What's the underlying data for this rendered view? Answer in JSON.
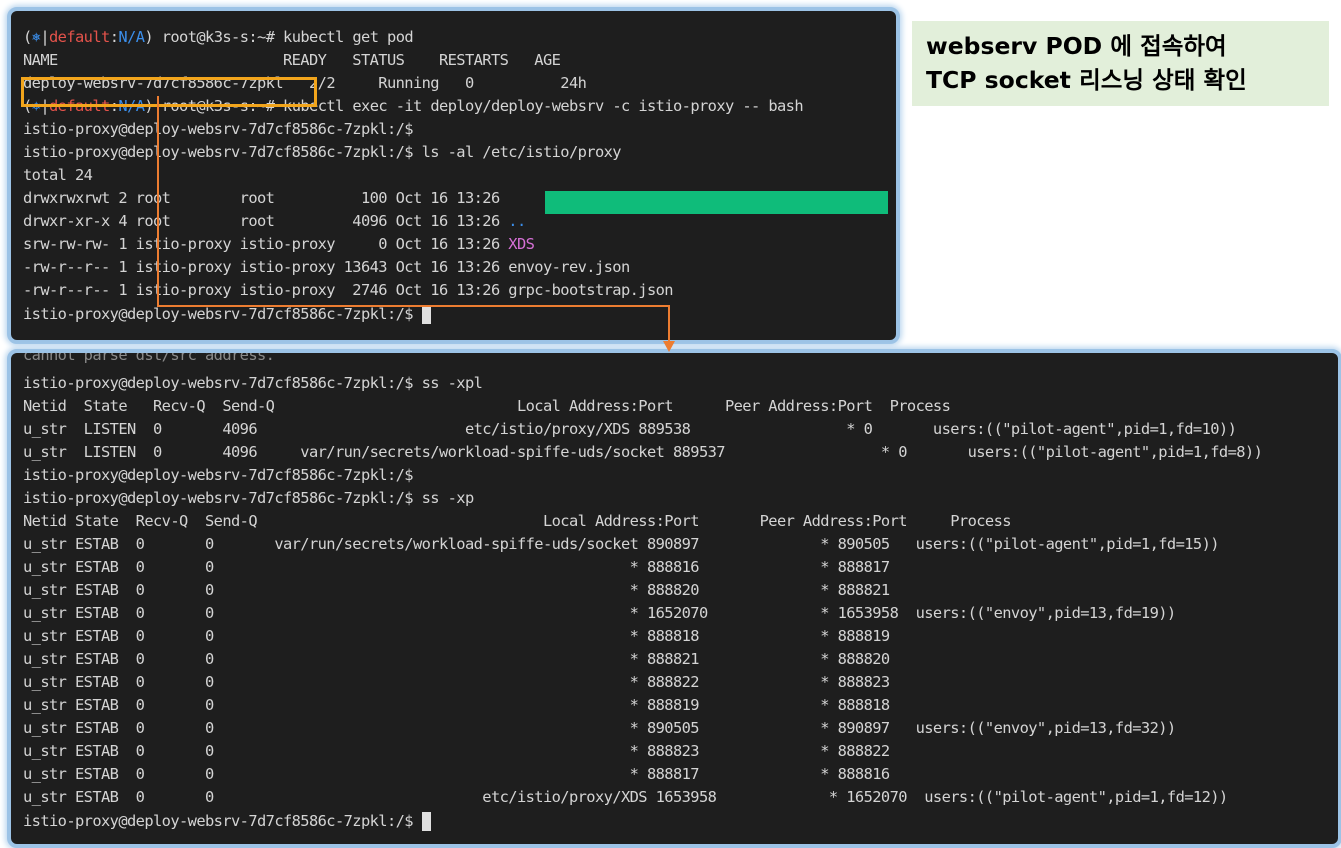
{
  "callout": {
    "line1": "webserv POD 에 접속하여",
    "line2": "TCP socket 리스닝 상태 확인"
  },
  "colors": {
    "terminal_bg": "#1e1e1e",
    "terminal_text": "#d4d4d4",
    "context_red": "#e5534b",
    "namespace_blue": "#3b8eea",
    "socket_magenta": "#d670d6",
    "dir_highlight_green": "#0fbc7a",
    "highlight_box_orange": "#f2a51c",
    "arrow_orange": "#ed7d31",
    "callout_bg": "#e2efda",
    "panel_border": "#9cc3e6"
  },
  "terminal1": {
    "prompt_star": "⎈",
    "prompt_ctx": "default",
    "prompt_ns": "N/A",
    "prompt_host": "root@k3s-s:~#",
    "cmd1": "kubectl get pod",
    "pod_header": "NAME                          READY   STATUS    RESTARTS   AGE",
    "pod_name": "deploy-websrv-7d7cf8586c-7zpkl",
    "pod_rest": "   2/2     Running   0          24h",
    "cmd2": "kubectl exec -it deploy/deploy-websrv -c istio-proxy -- bash",
    "shell_prompt": "istio-proxy@deploy-websrv-7d7cf8586c-7zpkl:/$",
    "cmd3": "ls -al /etc/istio/proxy",
    "total": "total 24",
    "files": [
      {
        "meta": "drwxrwxrwt 2 root        root          100 Oct 16 13:26 ",
        "name": "."
      },
      {
        "meta": "drwxr-xr-x 4 root        root         4096 Oct 16 13:26 ",
        "name": ".."
      },
      {
        "meta": "srw-rw-rw- 1 istio-proxy istio-proxy     0 Oct 16 13:26 ",
        "name": "XDS"
      },
      {
        "meta": "-rw-r--r-- 1 istio-proxy istio-proxy 13643 Oct 16 13:26 ",
        "name": "envoy-rev.json"
      },
      {
        "meta": "-rw-r--r-- 1 istio-proxy istio-proxy  2746 Oct 16 13:26 ",
        "name": "grpc-bootstrap.json"
      }
    ]
  },
  "terminal2": {
    "partial_top": "cannot parse dst/src address.",
    "shell_prompt": "istio-proxy@deploy-websrv-7d7cf8586c-7zpkl:/$",
    "cmd_xpl": "ss -xpl",
    "listen_header": "Netid  State   Recv-Q  Send-Q                            Local Address:Port      Peer Address:Port  Process",
    "listen_rows": [
      "u_str  LISTEN  0       4096                        etc/istio/proxy/XDS 889538                  * 0       users:((\"pilot-agent\",pid=1,fd=10))",
      "u_str  LISTEN  0       4096     var/run/secrets/workload-spiffe-uds/socket 889537                  * 0       users:((\"pilot-agent\",pid=1,fd=8))"
    ],
    "cmd_xp": "ss -xp",
    "estab_header": "Netid State  Recv-Q  Send-Q                                 Local Address:Port       Peer Address:Port     Process",
    "estab_rows": [
      "u_str ESTAB  0       0       var/run/secrets/workload-spiffe-uds/socket 890897              * 890505   users:((\"pilot-agent\",pid=1,fd=15))",
      "u_str ESTAB  0       0                                                * 888816              * 888817",
      "u_str ESTAB  0       0                                                * 888820              * 888821",
      "u_str ESTAB  0       0                                                * 1652070             * 1653958  users:((\"envoy\",pid=13,fd=19))",
      "u_str ESTAB  0       0                                                * 888818              * 888819",
      "u_str ESTAB  0       0                                                * 888821              * 888820",
      "u_str ESTAB  0       0                                                * 888822              * 888823",
      "u_str ESTAB  0       0                                                * 888819              * 888818",
      "u_str ESTAB  0       0                                                * 890505              * 890897   users:((\"envoy\",pid=13,fd=32))",
      "u_str ESTAB  0       0                                                * 888823              * 888822",
      "u_str ESTAB  0       0                                                * 888817              * 888816",
      "u_str ESTAB  0       0                               etc/istio/proxy/XDS 1653958             * 1652070  users:((\"pilot-agent\",pid=1,fd=12))"
    ]
  }
}
